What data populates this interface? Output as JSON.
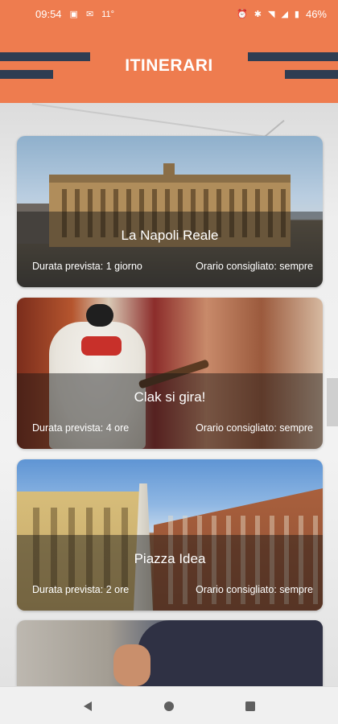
{
  "status_bar": {
    "time": "09:54",
    "temperature": "11°",
    "battery": "46%",
    "icons": [
      "sim-card-icon",
      "gmail-icon",
      "alarm-icon",
      "bluetooth-icon",
      "wifi-icon",
      "signal-icon",
      "battery-icon"
    ]
  },
  "header": {
    "title": "ITINERARI",
    "accent_color": "#ee7c4f",
    "stripe_color": "#2f3d52"
  },
  "itineraries": [
    {
      "title": "La Napoli Reale",
      "duration": "Durata prevista: 1 giorno",
      "schedule": "Orario consigliato: sempre"
    },
    {
      "title": "Clak si gira!",
      "duration": "Durata prevista: 4 ore",
      "schedule": "Orario consigliato: sempre"
    },
    {
      "title": "Piazza Idea",
      "duration": "Durata prevista: 2 ore",
      "schedule": "Orario consigliato: sempre"
    }
  ],
  "nav": {
    "icons": [
      "back-icon",
      "home-icon",
      "recents-icon"
    ]
  }
}
